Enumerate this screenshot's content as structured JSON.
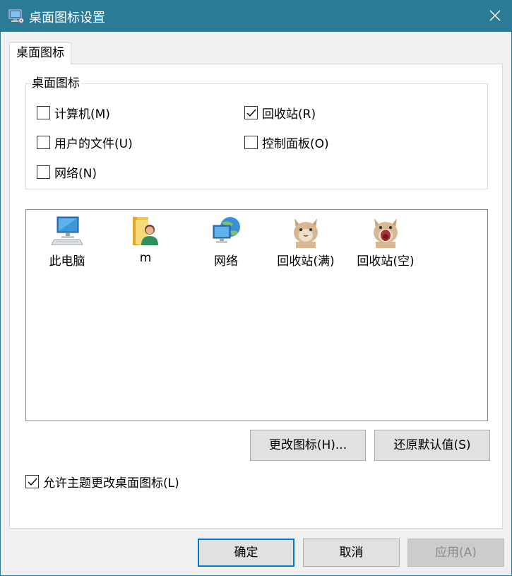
{
  "window": {
    "title": "桌面图标设置",
    "close_icon": "close-icon"
  },
  "tabs": [
    {
      "label": "桌面图标",
      "selected": true
    }
  ],
  "groupbox": {
    "title": "桌面图标",
    "items": [
      {
        "label": "计算机(M)",
        "checked": false
      },
      {
        "label": "回收站(R)",
        "checked": true
      },
      {
        "label": "用户的文件(U)",
        "checked": false
      },
      {
        "label": "控制面板(O)",
        "checked": false
      },
      {
        "label": "网络(N)",
        "checked": false
      }
    ]
  },
  "icons": [
    {
      "label": "此电脑",
      "icon": "computer-icon"
    },
    {
      "label": "m",
      "icon": "user-folder-icon"
    },
    {
      "label": "网络",
      "icon": "network-icon"
    },
    {
      "label": "回收站(满)",
      "icon": "cat-icon-full"
    },
    {
      "label": "回收站(空)",
      "icon": "cat-icon-empty"
    }
  ],
  "buttons": {
    "change_icon": "更改图标(H)...",
    "restore_default": "还原默认值(S)",
    "ok": "确定",
    "cancel": "取消",
    "apply": "应用(A)"
  },
  "allow_themes": {
    "label": "允许主题更改桌面图标(L)",
    "checked": true
  },
  "colors": {
    "titlebar": "#2b7a96",
    "focus_border": "#0078d7",
    "window_bg": "#f0f0f0"
  }
}
